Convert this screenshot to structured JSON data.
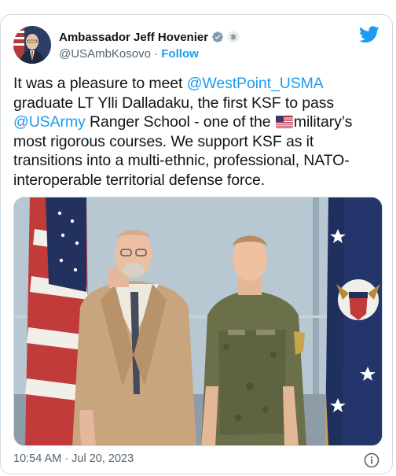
{
  "author": {
    "display_name": "Ambassador Jeff Hovenier",
    "handle": "@USAmbKosovo",
    "separator": " · ",
    "follow_label": "Follow"
  },
  "tweet": {
    "p1": "It was a pleasure to meet ",
    "mention1": "@WestPoint_USMA",
    "p2": " graduate LT Ylli Dalladaku, the first KSF to pass ",
    "mention2": "@USArmy",
    "p3": " Ranger School - one of the ",
    "p4": "military’s most rigorous courses. We support KSF as it transitions into a multi-ethnic, professional, NATO-interoperable territorial defense force."
  },
  "meta": {
    "timestamp": "10:54 AM · Jul 20, 2023"
  },
  "icons": {
    "verified": "gray-verified-badge-icon",
    "affiliate": "us-seal-icon",
    "brand": "twitter-bird-icon",
    "flag": "us-flag-emoji-icon",
    "info": "info-icon"
  },
  "colors": {
    "link": "#1d9bf0",
    "text": "#0f1419",
    "secondary": "#536471",
    "border": "#cfd9de"
  }
}
